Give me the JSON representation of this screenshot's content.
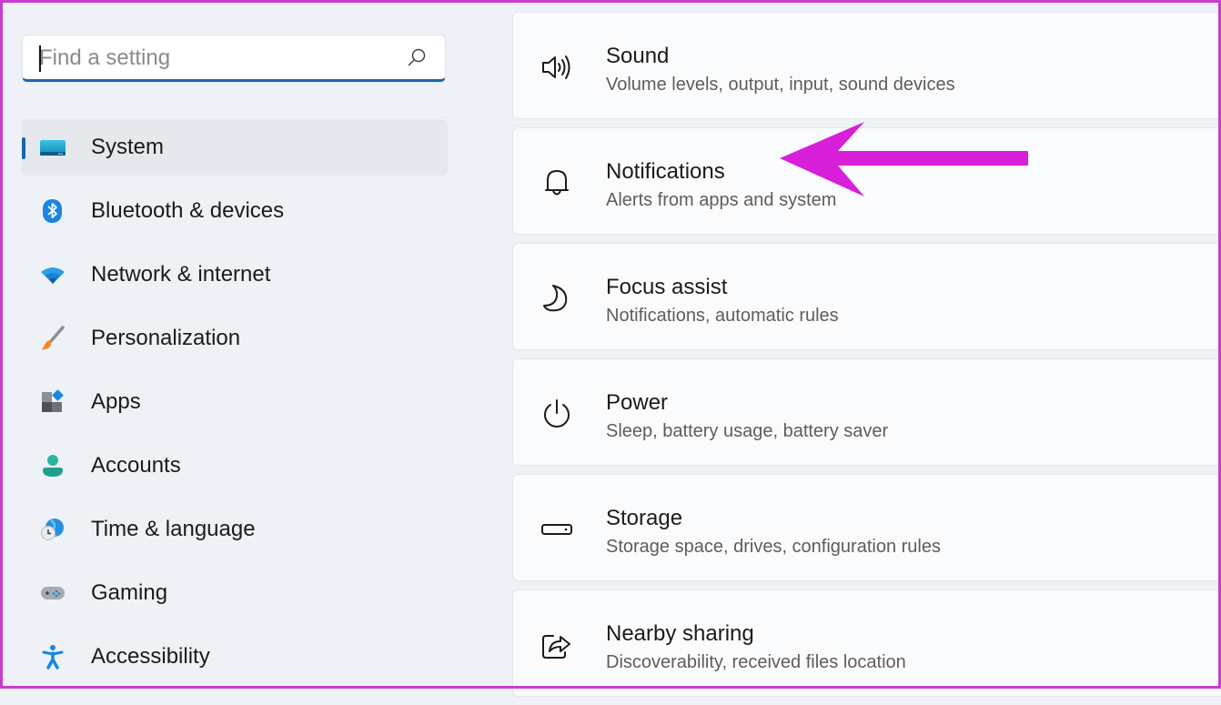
{
  "search": {
    "placeholder": "Find a setting",
    "value": ""
  },
  "sidebar": {
    "selected": "System",
    "accent_color": "#1a64b0",
    "items": [
      {
        "label": "System",
        "icon": "system-display-icon"
      },
      {
        "label": "Bluetooth & devices",
        "icon": "bluetooth-icon"
      },
      {
        "label": "Network & internet",
        "icon": "wifi-icon"
      },
      {
        "label": "Personalization",
        "icon": "paintbrush-icon"
      },
      {
        "label": "Apps",
        "icon": "apps-icon"
      },
      {
        "label": "Accounts",
        "icon": "account-icon"
      },
      {
        "label": "Time & language",
        "icon": "time-language-icon"
      },
      {
        "label": "Gaming",
        "icon": "gamepad-icon"
      },
      {
        "label": "Accessibility",
        "icon": "accessibility-icon"
      }
    ]
  },
  "main": {
    "cards": [
      {
        "title": "Sound",
        "subtitle": "Volume levels, output, input, sound devices",
        "icon": "speaker-icon"
      },
      {
        "title": "Notifications",
        "subtitle": "Alerts from apps and system",
        "icon": "bell-icon"
      },
      {
        "title": "Focus assist",
        "subtitle": "Notifications, automatic rules",
        "icon": "moon-icon"
      },
      {
        "title": "Power",
        "subtitle": "Sleep, battery usage, battery saver",
        "icon": "power-icon"
      },
      {
        "title": "Storage",
        "subtitle": "Storage space, drives, configuration rules",
        "icon": "storage-drive-icon"
      },
      {
        "title": "Nearby sharing",
        "subtitle": "Discoverability, received files location",
        "icon": "share-icon"
      }
    ]
  },
  "annotation": {
    "type": "arrow",
    "points_to": "Notifications",
    "color": "#d81fd9"
  },
  "frame_color": "#c93ccf"
}
